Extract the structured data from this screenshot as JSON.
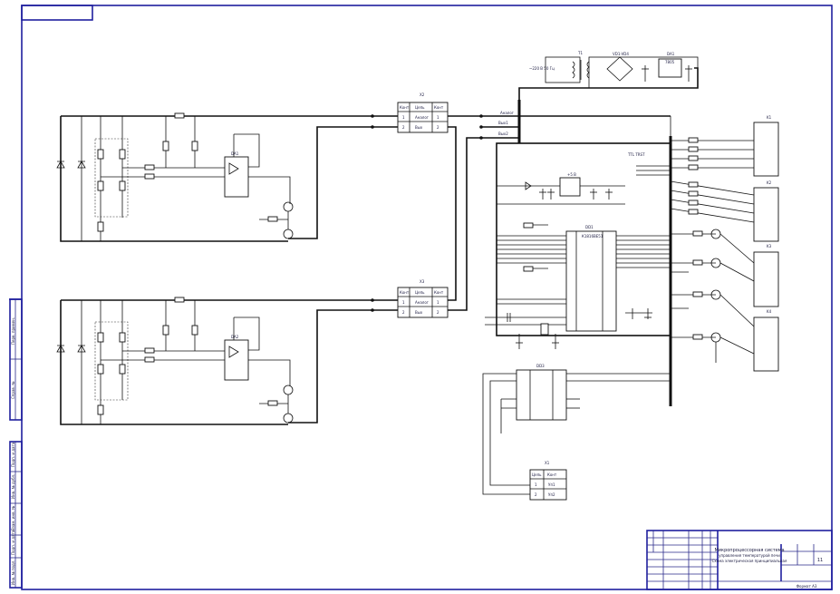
{
  "title_block": {
    "title_lines": [
      "Микропроцессорная система",
      "управления температурой печи",
      "Схема электрическая принципиальная"
    ],
    "sheet": "11",
    "format": "Формат A3"
  },
  "side_stamps": [
    "Перв. примен.",
    "Справ. №",
    "Подп. и дата",
    "Инв. № дубл.",
    "Взам. инв. №",
    "Подп. и дата",
    "Инв. № подл."
  ],
  "components": {
    "x1": {
      "ref": "X1",
      "pins": [
        "1",
        "2"
      ],
      "cols": [
        "Цепь",
        "Конт"
      ],
      "rows": [
        [
          "1",
          "Уп1"
        ],
        [
          "2",
          "Уп2"
        ]
      ]
    },
    "x2": {
      "ref": "X2",
      "cols": [
        "Конт",
        "Цепь",
        "Конт"
      ],
      "rows": [
        [
          "1",
          "Аналог",
          "1"
        ],
        [
          "2",
          "Вых",
          "2"
        ]
      ]
    },
    "x3": {
      "ref": "X3",
      "cols": [
        "Конт",
        "Цепь",
        "Конт"
      ],
      "rows": [
        [
          "1",
          "Аналог",
          "1"
        ],
        [
          "2",
          "Вых",
          "2"
        ]
      ]
    },
    "power": {
      "input": "~220 В 50 Гц",
      "transformer": "T1",
      "bridge": "VD1-VD4",
      "regulator": "DA1",
      "regulator_type": "7805"
    },
    "mcu": {
      "ref": "DD1",
      "type": "К1816ВЕ51",
      "vdd_label": "+5 В"
    },
    "adc": {
      "ref": "DD3"
    },
    "relays": [
      "K1",
      "K2",
      "K3",
      "K4"
    ],
    "ttl": "TTL TRST"
  },
  "signals": {
    "analog": "Аналог",
    "out1": "Вых1",
    "out2": "Вых2",
    "sh": "Ш"
  }
}
